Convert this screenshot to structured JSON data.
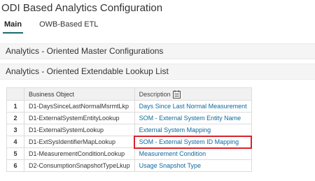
{
  "page": {
    "title": "ODI Based Analytics Configuration"
  },
  "tabs": [
    {
      "label": "Main"
    },
    {
      "label": "OWB-Based ETL"
    }
  ],
  "sections": {
    "master_configs": "Analytics - Oriented Master Configurations",
    "lookup_list": "Analytics - Oriented Extendable Lookup List"
  },
  "table": {
    "headers": {
      "business_object": "Business Object",
      "description": "Description"
    },
    "rows": [
      {
        "num": "1",
        "business_object": "D1-DaysSinceLastNormalMsrmtLkp",
        "description": "Days Since Last Normal Measurement"
      },
      {
        "num": "2",
        "business_object": "D1-ExternalSystemEntityLookup",
        "description": "SOM - External System Entity Name"
      },
      {
        "num": "3",
        "business_object": "D1-ExternalSystemLookup",
        "description": "External System Mapping"
      },
      {
        "num": "4",
        "business_object": "D1-ExtSysIdentifierMapLookup",
        "description": "SOM - External System ID Mapping"
      },
      {
        "num": "5",
        "business_object": "D1-MeasurementConditionLookup",
        "description": "Measurement Condition"
      },
      {
        "num": "6",
        "business_object": "D2-ConsumptionSnapshotTypeLkup",
        "description": "Usage Snapshot Type"
      }
    ]
  },
  "icons": {
    "description_header": "filter-list-icon"
  },
  "colors": {
    "link": "#0e6a9e",
    "tab_underline": "#1c6c6c",
    "highlight_border": "#d9232b"
  }
}
